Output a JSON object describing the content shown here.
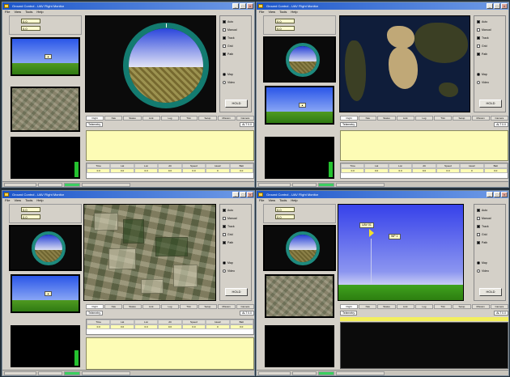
{
  "windows": [
    {
      "id": "a",
      "view": "attitude",
      "title": "Ground Control - UAV Flight Monitor",
      "readouts": [
        "0.0",
        "0.0"
      ],
      "video_label": "",
      "status_left": "Telemetry",
      "status_right": "ALT 0.0",
      "tabs": [
        "Flight",
        "Nav",
        "Status",
        "Link",
        "Log",
        "Trim",
        "Setup",
        "Mission",
        "Camera"
      ],
      "table_headers": [
        "Time",
        "Lat",
        "Lon",
        "Alt",
        "Speed",
        "Head",
        "Batt"
      ],
      "table_values": [
        "0.0",
        "0.0",
        "0.0",
        "0.0",
        "0.0",
        "0",
        "0.0"
      ],
      "button": "HOLD"
    },
    {
      "id": "b",
      "view": "world-map",
      "title": "Ground Control - UAV Flight Monitor",
      "readouts": [
        "0.0",
        "0.0"
      ],
      "video_label": "",
      "status_left": "Telemetry",
      "status_right": "ALT 0.0",
      "tabs": [
        "Flight",
        "Nav",
        "Status",
        "Link",
        "Log",
        "Trim",
        "Setup",
        "Mission",
        "Camera"
      ],
      "table_headers": [
        "Time",
        "Lat",
        "Lon",
        "Alt",
        "Speed",
        "Head",
        "Batt"
      ],
      "table_values": [
        "0.0",
        "0.0",
        "0.0",
        "0.0",
        "0.0",
        "0",
        "0.0"
      ],
      "button": "HOLD"
    },
    {
      "id": "c",
      "view": "satellite",
      "title": "Ground Control - UAV Flight Monitor",
      "readouts": [
        "0.0",
        "0.0"
      ],
      "video_label": "",
      "status_left": "Telemetry",
      "status_right": "ALT 0.0",
      "tabs": [
        "Flight",
        "Nav",
        "Status",
        "Link",
        "Log",
        "Trim",
        "Setup",
        "Mission",
        "Camera"
      ],
      "table_headers": [
        "Time",
        "Lat",
        "Lon",
        "Alt",
        "Speed",
        "Head",
        "Batt"
      ],
      "table_values": [
        "0.0",
        "0.0",
        "0.0",
        "0.0",
        "0.0",
        "0",
        "0.0"
      ],
      "button": "HOLD"
    },
    {
      "id": "d",
      "view": "simulation",
      "title": "Ground Control - UAV Flight Monitor",
      "readouts": [
        "0.0",
        "0.0"
      ],
      "video_label": "",
      "status_left": "Telemetry",
      "status_right": "ALT 0.0",
      "tabs": [
        "Flight",
        "Nav",
        "Status",
        "Link",
        "Log",
        "Trim",
        "Setup",
        "Mission",
        "Camera"
      ],
      "table_headers": [],
      "table_values": [],
      "button": "HOLD",
      "sim_tags": [
        "UAV 01",
        "WP 1"
      ]
    }
  ],
  "menu": [
    "File",
    "View",
    "Tools",
    "Help"
  ],
  "checkboxes": [
    "Auto",
    "Manual",
    "Track",
    "Grid",
    "Path"
  ],
  "radios": [
    "Map",
    "Video"
  ],
  "colors": {
    "titlebar": "#1b55c9",
    "panel": "#d4d0c8",
    "log_area": "#fdfcb5",
    "sky": "#2a56e8",
    "ground": "#4f9a21",
    "indicator_ring": "#1e8a7e",
    "status_ok": "#3bd060"
  }
}
